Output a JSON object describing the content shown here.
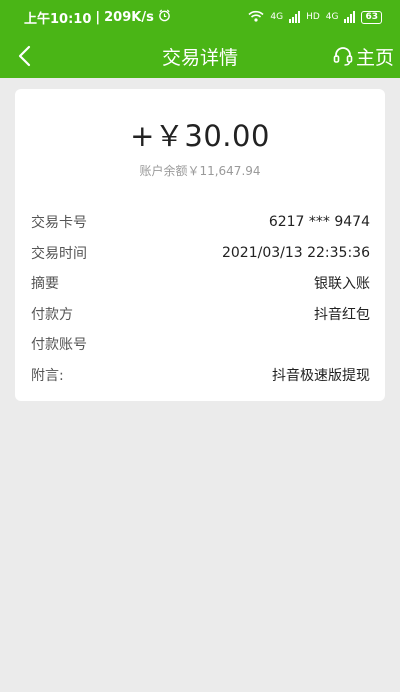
{
  "status_bar": {
    "time": "上午10:10",
    "speed": "209K/s",
    "network_1": "4G",
    "network_2": "4G",
    "hd": "HD",
    "battery": "63"
  },
  "nav": {
    "title": "交易详情",
    "home_label": "主页"
  },
  "transaction": {
    "amount": "+￥30.00",
    "balance": "账户余额￥11,647.94",
    "rows": [
      {
        "label": "交易卡号",
        "value": "6217 *** 9474"
      },
      {
        "label": "交易时间",
        "value": "2021/03/13 22:35:36"
      },
      {
        "label": "摘要",
        "value": "银联入账"
      },
      {
        "label": "付款方",
        "value": "抖音红包"
      },
      {
        "label": "付款账号",
        "value": ""
      },
      {
        "label": "附言:",
        "value": "抖音极速版提现"
      }
    ]
  },
  "colors": {
    "header_green": "#4ab516",
    "background": "#ebebeb"
  },
  "icons": [
    "alarm-icon",
    "wifi-icon",
    "signal-icon",
    "battery-icon",
    "back-arrow-icon",
    "headset-icon"
  ]
}
